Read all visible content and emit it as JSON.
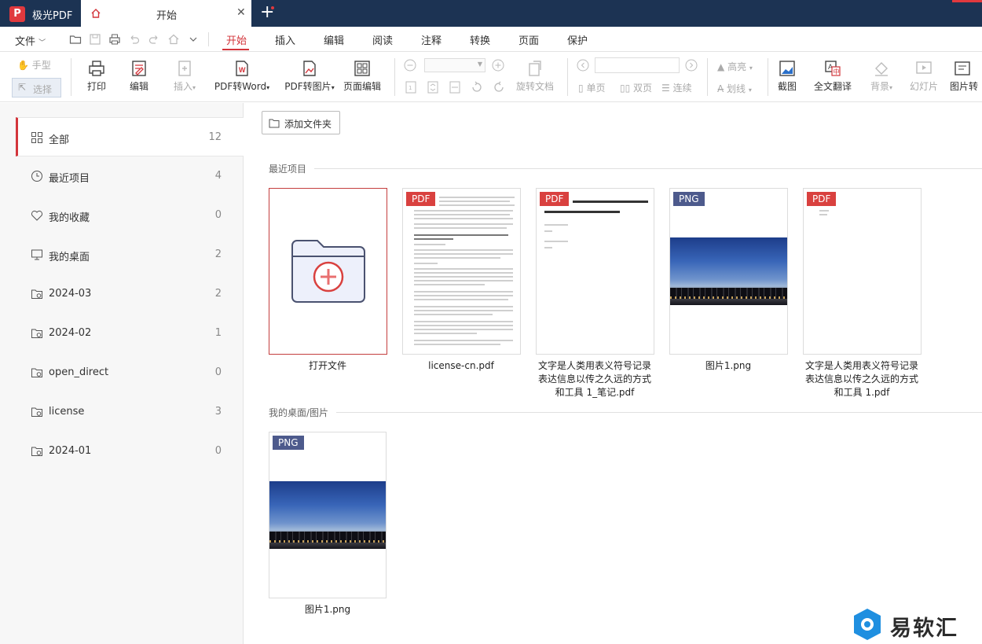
{
  "app": {
    "name": "极光PDF",
    "logo_letter": "P",
    "brand_color": "#e0393e",
    "titlebar_color": "#1c3353"
  },
  "tabs": [
    {
      "label": "开始",
      "icon": "home-icon"
    }
  ],
  "menu": {
    "file": "文件",
    "items": [
      "开始",
      "插入",
      "编辑",
      "阅读",
      "注释",
      "转换",
      "页面",
      "保护"
    ],
    "active": "开始"
  },
  "ribbon": {
    "hand": "手型",
    "select": "选择",
    "print": "打印",
    "edit": "编辑",
    "insert": "插入",
    "pdf_to_word": "PDF转Word",
    "pdf_to_image": "PDF转图片",
    "page_edit": "页面编辑",
    "rotate_doc": "旋转文档",
    "single_page": "单页",
    "double_page": "双页",
    "continuous": "连续",
    "highlight": "高亮",
    "strikethrough": "划线",
    "screenshot": "截图",
    "translate": "全文翻译",
    "background": "背景",
    "slideshow": "幻灯片",
    "image_to": "图片转"
  },
  "sidebar": {
    "items": [
      {
        "label": "全部",
        "count": "12",
        "icon": "grid-icon"
      },
      {
        "label": "最近项目",
        "count": "4",
        "icon": "clock-icon"
      },
      {
        "label": "我的收藏",
        "count": "0",
        "icon": "heart-icon"
      },
      {
        "label": "我的桌面",
        "count": "2",
        "icon": "monitor-icon"
      },
      {
        "label": "2024-03",
        "count": "2",
        "icon": "folder-icon"
      },
      {
        "label": "2024-02",
        "count": "1",
        "icon": "folder-icon"
      },
      {
        "label": "open_direct",
        "count": "0",
        "icon": "folder-icon"
      },
      {
        "label": "license",
        "count": "3",
        "icon": "folder-icon"
      },
      {
        "label": "2024-01",
        "count": "0",
        "icon": "folder-icon"
      }
    ]
  },
  "main": {
    "add_folder": "添加文件夹",
    "sections": [
      {
        "title": "最近项目",
        "files": [
          {
            "name": "打开文件",
            "type": "open"
          },
          {
            "name": "license-cn.pdf",
            "type": "PDF"
          },
          {
            "name_lines": [
              "文字是人类用表义符号记录",
              "表达信息以传之久远的方式",
              "和工具 1_笔记.pdf"
            ],
            "type": "PDF"
          },
          {
            "name": "图片1.png",
            "type": "PNG"
          },
          {
            "name_lines": [
              "文字是人类用表义符号记录",
              "表达信息以传之久远的方式",
              "和工具 1.pdf"
            ],
            "type": "PDF"
          }
        ]
      },
      {
        "title": "我的桌面/图片",
        "files": [
          {
            "name": "图片1.png",
            "type": "PNG"
          }
        ]
      }
    ]
  },
  "watermark": "易软汇"
}
